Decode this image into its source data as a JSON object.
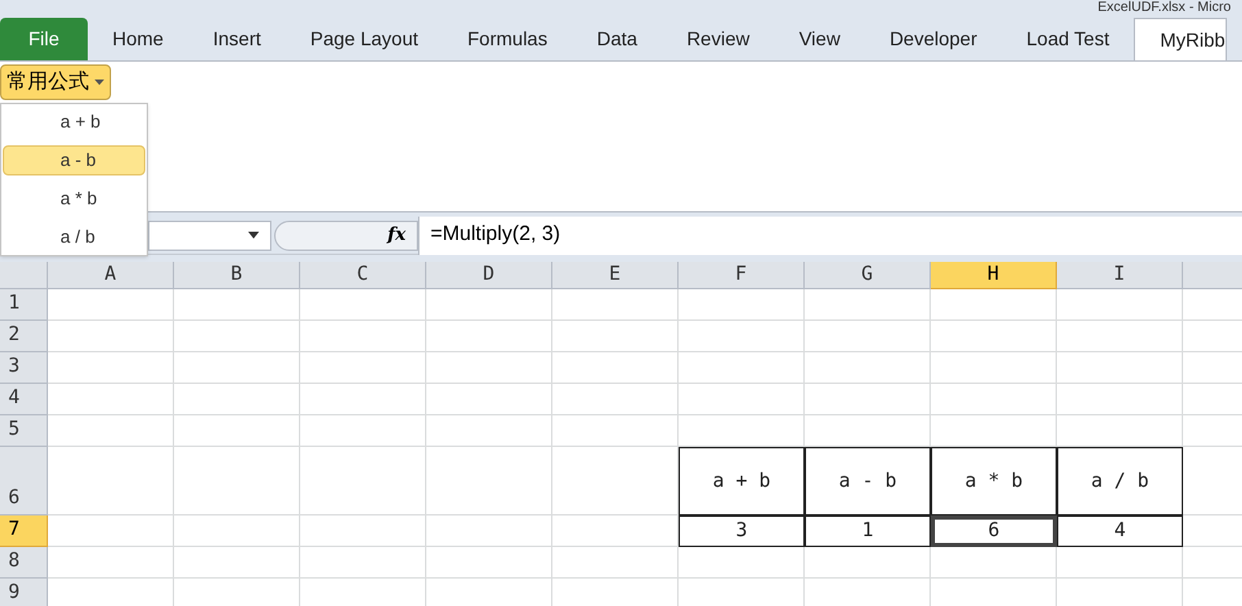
{
  "title_bar": {
    "title": "ExcelUDF.xlsx - Micro"
  },
  "tabs": [
    {
      "label": "File",
      "kind": "file",
      "selected": false
    },
    {
      "label": "Home",
      "kind": "tab",
      "selected": false
    },
    {
      "label": "Insert",
      "kind": "tab",
      "selected": false
    },
    {
      "label": "Page Layout",
      "kind": "tab",
      "selected": false
    },
    {
      "label": "Formulas",
      "kind": "tab",
      "selected": false
    },
    {
      "label": "Data",
      "kind": "tab",
      "selected": false
    },
    {
      "label": "Review",
      "kind": "tab",
      "selected": false
    },
    {
      "label": "View",
      "kind": "tab",
      "selected": false
    },
    {
      "label": "Developer",
      "kind": "tab",
      "selected": false
    },
    {
      "label": "Load Test",
      "kind": "tab",
      "selected": false
    },
    {
      "label": "MyRibb",
      "kind": "tab",
      "selected": true
    }
  ],
  "ribbon": {
    "dropdown_button": {
      "label": "常用公式",
      "expanded": true
    }
  },
  "menu": {
    "items": [
      {
        "label": "a + b",
        "selected": false
      },
      {
        "label": "a - b",
        "selected": true
      },
      {
        "label": "a * b",
        "selected": false
      },
      {
        "label": "a / b",
        "selected": false
      }
    ]
  },
  "formula_bar": {
    "fx": "fx",
    "formula": "=Multiply(2, 3)"
  },
  "sheet": {
    "columns": [
      {
        "label": "A",
        "selected": false
      },
      {
        "label": "B",
        "selected": false
      },
      {
        "label": "C",
        "selected": false
      },
      {
        "label": "D",
        "selected": false
      },
      {
        "label": "E",
        "selected": false
      },
      {
        "label": "F",
        "selected": false
      },
      {
        "label": "G",
        "selected": false
      },
      {
        "label": "H",
        "selected": true
      },
      {
        "label": "I",
        "selected": false
      }
    ],
    "rows": [
      {
        "label": "1",
        "selected": false
      },
      {
        "label": "2",
        "selected": false
      },
      {
        "label": "3",
        "selected": false
      },
      {
        "label": "4",
        "selected": false
      },
      {
        "label": "5",
        "selected": false
      },
      {
        "label": "6",
        "selected": false
      },
      {
        "label": "7",
        "selected": true
      },
      {
        "label": "8",
        "selected": false
      },
      {
        "label": "9",
        "selected": false
      }
    ],
    "table": {
      "rows": [
        {
          "cells": [
            {
              "text": "a + b",
              "selected": false
            },
            {
              "text": "a - b",
              "selected": false
            },
            {
              "text": "a * b",
              "selected": false
            },
            {
              "text": "a / b",
              "selected": false
            }
          ]
        },
        {
          "cells": [
            {
              "text": "3",
              "selected": false
            },
            {
              "text": "1",
              "selected": false
            },
            {
              "text": "6",
              "selected": true
            },
            {
              "text": "4",
              "selected": false
            }
          ]
        }
      ]
    }
  }
}
